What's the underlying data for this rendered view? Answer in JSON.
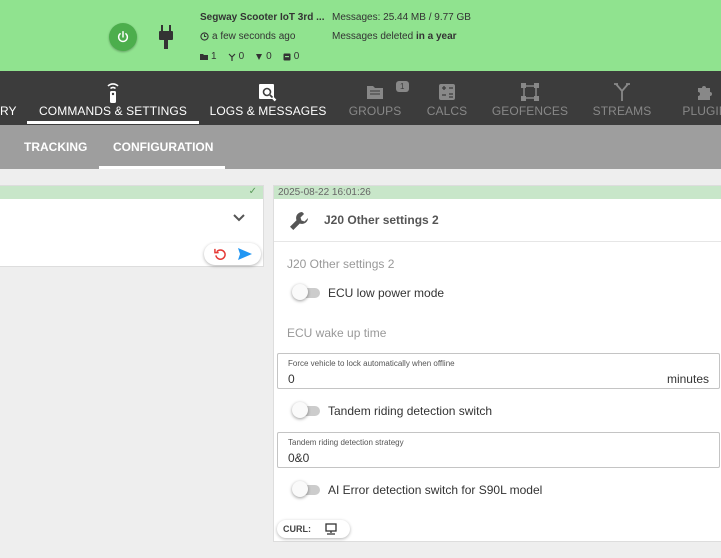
{
  "device": {
    "name": "Segway Scooter IoT 3rd ...",
    "last_seen": "a few seconds ago",
    "counters": [
      "1",
      "0",
      "0",
      "0"
    ],
    "messages_size": "Messages: 25.44 MB / 9.77 GB",
    "messages_deleted_prefix": "Messages deleted",
    "messages_deleted_when": "in a year",
    "status_color": "#90e38f"
  },
  "main_tabs": [
    {
      "label": "RY"
    },
    {
      "label": "COMMANDS & SETTINGS"
    },
    {
      "label": "LOGS & MESSAGES"
    },
    {
      "label": "GROUPS",
      "badge": "1"
    },
    {
      "label": "CALCS"
    },
    {
      "label": "GEOFENCES"
    },
    {
      "label": "STREAMS"
    },
    {
      "label": "PLUGIN"
    }
  ],
  "sub_tabs": [
    {
      "label": "TRACKING"
    },
    {
      "label": "CONFIGURATION"
    }
  ],
  "panel": {
    "timestamp": "2025-08-22 16:01:26",
    "title": "J20 Other settings 2",
    "section_label": "J20 Other settings 2",
    "ecu_low_power": {
      "label": "ECU low power mode",
      "on": false
    },
    "ecu_wake_label": "ECU wake up time",
    "force_lock": {
      "label": "Force vehicle to lock automatically when offline",
      "value": "0",
      "unit": "minutes"
    },
    "tandem_switch": {
      "label": "Tandem riding detection switch",
      "on": false
    },
    "tandem_strategy": {
      "label": "Tandem riding detection strategy",
      "value": "0&0"
    },
    "ai_error": {
      "label": "AI Error detection switch for S90L model",
      "on": false
    },
    "curl_label": "CURL:"
  },
  "colors": {
    "accent_green": "#4cae4c",
    "dark_bar": "#3c3c3c",
    "sub_bar": "#9e9e9e",
    "reset_red": "#e53935",
    "send_blue": "#2196f3"
  }
}
